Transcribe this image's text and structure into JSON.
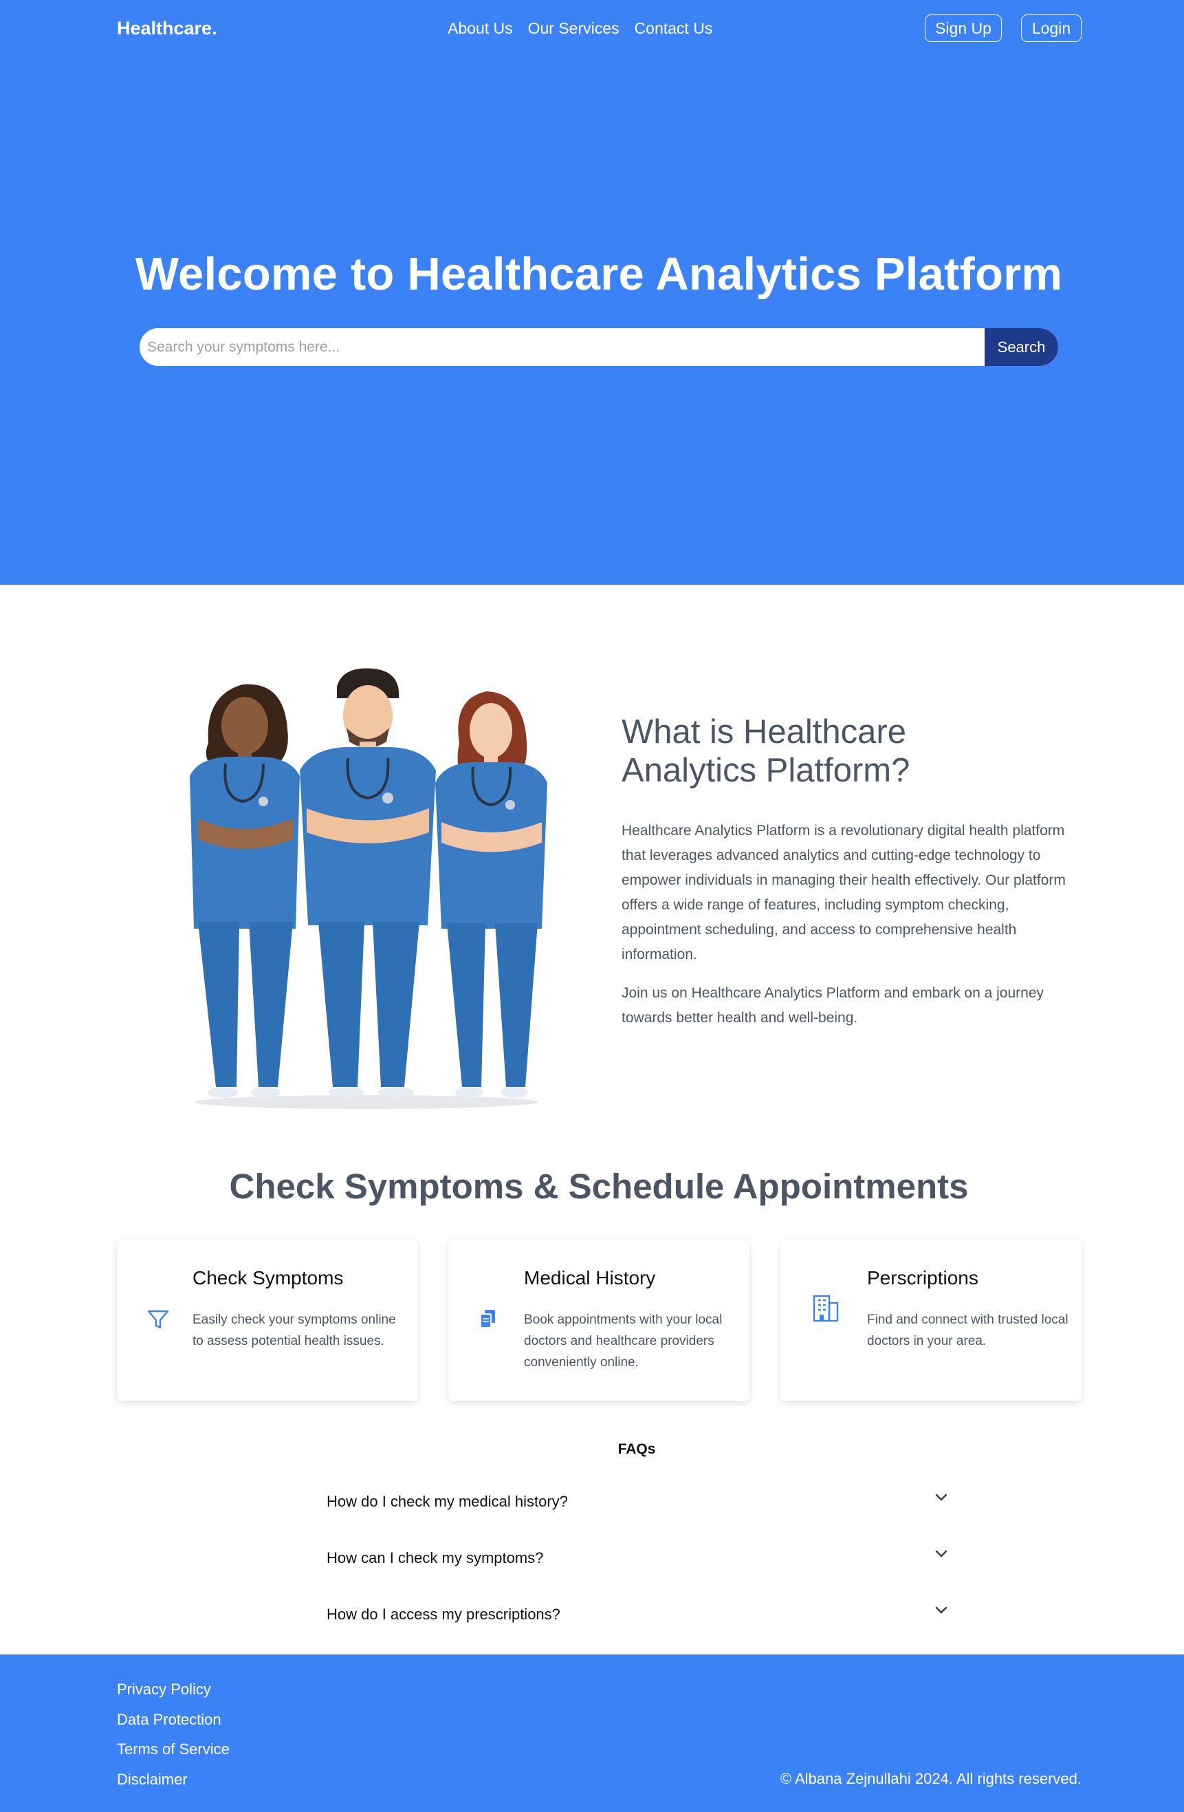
{
  "header": {
    "brand": "Healthcare.",
    "nav": [
      "About Us",
      "Our Services",
      "Contact Us"
    ],
    "signup_label": "Sign Up",
    "login_label": "Login"
  },
  "hero": {
    "title": "Welcome to Healthcare Analytics Platform",
    "search_placeholder": "Search your symptoms here...",
    "search_button": "Search"
  },
  "about": {
    "title": "What is Healthcare Analytics Platform?",
    "paragraph1": "Healthcare Analytics Platform is a revolutionary digital health platform that leverages advanced analytics and cutting-edge technology to empower individuals in managing their health effectively. Our platform offers a wide range of features, including symptom checking, appointment scheduling, and access to comprehensive health information.",
    "paragraph2": "Join us on Healthcare Analytics Platform and embark on a journey towards better health and well-being."
  },
  "services": {
    "title": "Check Symptoms & Schedule Appointments",
    "cards": [
      {
        "icon": "filter-icon",
        "title": "Check Symptoms",
        "desc": "Easily check your symptoms online to assess potential health issues."
      },
      {
        "icon": "documents-icon",
        "title": "Medical History",
        "desc": "Book appointments with your local doctors and healthcare providers conveniently online."
      },
      {
        "icon": "building-icon",
        "title": "Perscriptions",
        "desc": "Find and connect with trusted local doctors in your area."
      }
    ]
  },
  "faq": {
    "heading": "FAQs",
    "items": [
      "How do I check my medical history?",
      "How can I check my symptoms?",
      "How do I access my prescriptions?"
    ]
  },
  "footer": {
    "links": [
      "Privacy Policy",
      "Data Protection",
      "Terms of Service",
      "Disclaimer"
    ],
    "copyright": "© Albana Zejnullahi 2024. All rights reserved."
  },
  "colors": {
    "primary": "#3b82f6",
    "search_button": "#1e3a8a",
    "heading_gray": "#4b5563",
    "scrubs": "#3a7cc3"
  }
}
